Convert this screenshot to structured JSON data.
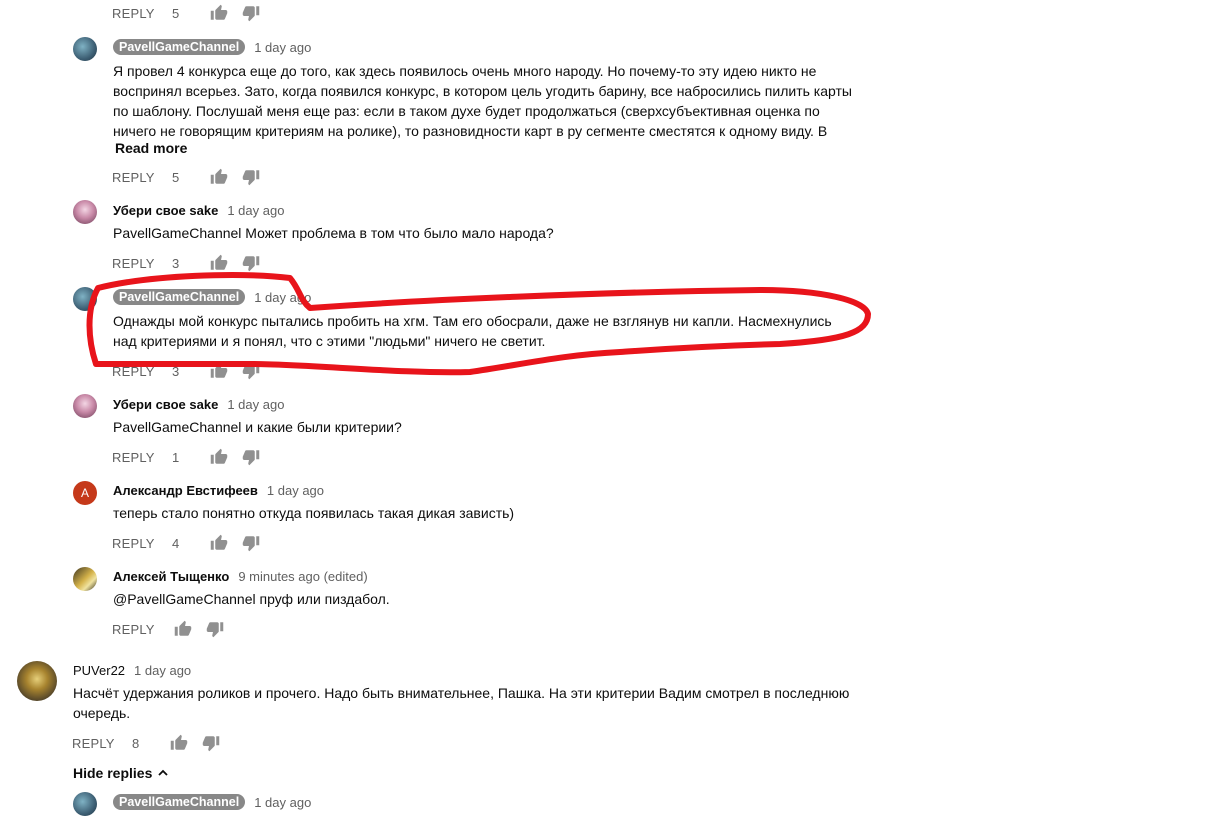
{
  "reply_label": "REPLY",
  "read_more_label": "Read more",
  "hide_replies_label": "Hide replies",
  "annotation_color": "#e8141b",
  "comments": [
    {
      "like_count": "5"
    },
    {
      "author": "PavellGameChannel",
      "time": "1 day ago",
      "lines": [
        "Я провел 4 конкурса еще до того, как здесь появилось очень много народу. Но почему-то эту идею никто не",
        "воспринял всерьез. Зато, когда появился конкурс, в котором цель угодить барину, все набросились пилить карты",
        "по шаблону. Послушай меня еще раз: если в таком духе будет продолжаться (сверхсубъективная оценка по",
        "ничего не говорящим критериям на ролике), то разновидности карт в ру сегменте сместятся к одному виду. В"
      ],
      "like_count": "5"
    },
    {
      "author": "Убери свое sake",
      "time": "1 day ago",
      "text": "PavellGameChannel  Может проблема в том что было мало народа?",
      "like_count": "3"
    },
    {
      "author": "PavellGameChannel",
      "time": "1 day ago",
      "lines": [
        "Однажды мой конкурс пытались пробить на хгм. Там его обосрали, даже не взглянув ни капли. Насмехнулись",
        "над критериями и я понял, что с этими \"людьми\" ничего не светит."
      ],
      "like_count": "3"
    },
    {
      "author": "Убери свое sake",
      "time": "1 day ago",
      "text": "PavellGameChannel и какие были критерии?",
      "like_count": "1"
    },
    {
      "author": "Александр Евстифеев",
      "avatar_letter": "А",
      "avatar_color": "#c5391a",
      "time": "1 day ago",
      "text": "теперь стало понятно откуда появилась такая дикая зависть)",
      "like_count": "4"
    },
    {
      "author": "Алексей Тыщенко",
      "time": "9 minutes ago (edited)",
      "text": "@PavellGameChannel пруф или пиздабол."
    },
    {
      "author": "PUVer22",
      "time": "1 day ago",
      "lines": [
        "Насчёт удержания роликов и прочего. Надо быть внимательнее, Пашка. На эти критерии Вадим смотрел в последнюю",
        "очередь."
      ],
      "like_count": "8"
    },
    {
      "author": "PavellGameChannel",
      "time": "1 day ago"
    }
  ]
}
